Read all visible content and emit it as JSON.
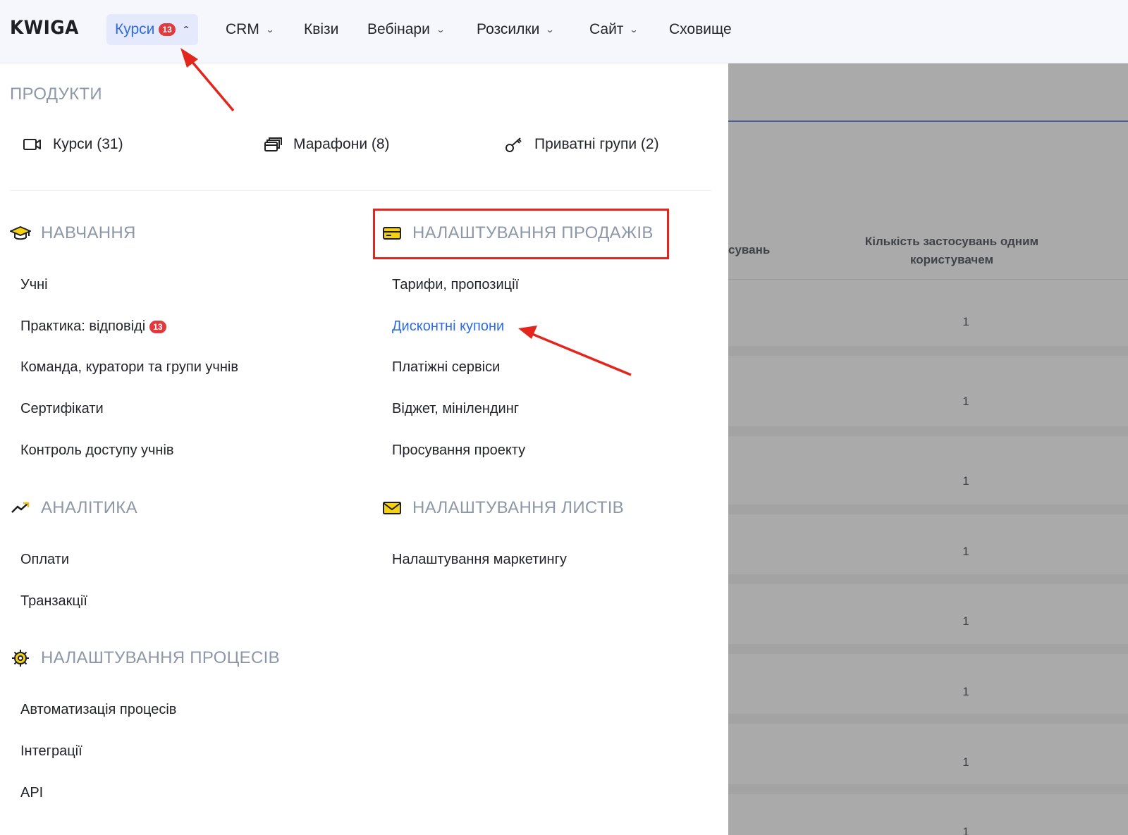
{
  "brand": {
    "logo": "KWIGA"
  },
  "nav": {
    "courses": {
      "label": "Курси",
      "badge": "13"
    },
    "crm": "CRM",
    "quizzes": "Квізи",
    "webinars": "Вебінари",
    "mailings": "Розсилки",
    "site": "Сайт",
    "storage": "Сховище"
  },
  "products": {
    "heading": "ПРОДУКТИ",
    "courses": "Курси (31)",
    "marathons": "Марафони (8)",
    "private_groups": "Приватні групи (2)"
  },
  "learning": {
    "heading": "НАВЧАННЯ",
    "students": "Учні",
    "practice": "Практика: відповіді",
    "practice_badge": "13",
    "team": "Команда, куратори та групи учнів",
    "certificates": "Сертифікати",
    "access": "Контроль доступу учнів"
  },
  "sales": {
    "heading": "НАЛАШТУВАННЯ ПРОДАЖІВ",
    "tariffs": "Тарифи, пропозиції",
    "coupons": "Дисконтні купони",
    "payments": "Платіжні сервіси",
    "widget": "Віджет, мінілендинг",
    "promotion": "Просування проекту"
  },
  "analytics": {
    "heading": "АНАЛІТИКА",
    "payments": "Оплати",
    "transactions": "Транзакції"
  },
  "letters": {
    "heading": "НАЛАШТУВАННЯ ЛИСТІВ",
    "marketing": "Налаштування маркетингу"
  },
  "processes": {
    "heading": "НАЛАШТУВАННЯ ПРОЦЕСІВ",
    "automation": "Автоматизація процесів",
    "integrations": "Інтеграції",
    "api": "API"
  },
  "background_table": {
    "col_partial": "сувань",
    "col_per_user": "Кількість застосувань одним користувачем",
    "values": [
      "1",
      "1",
      "1",
      "1",
      "1",
      "1",
      "1",
      "1"
    ]
  },
  "colors": {
    "accent": "#2f6be3",
    "badge": "#e2393e",
    "annotation": "#e3261d",
    "icon_yellow": "#f5d10f"
  }
}
